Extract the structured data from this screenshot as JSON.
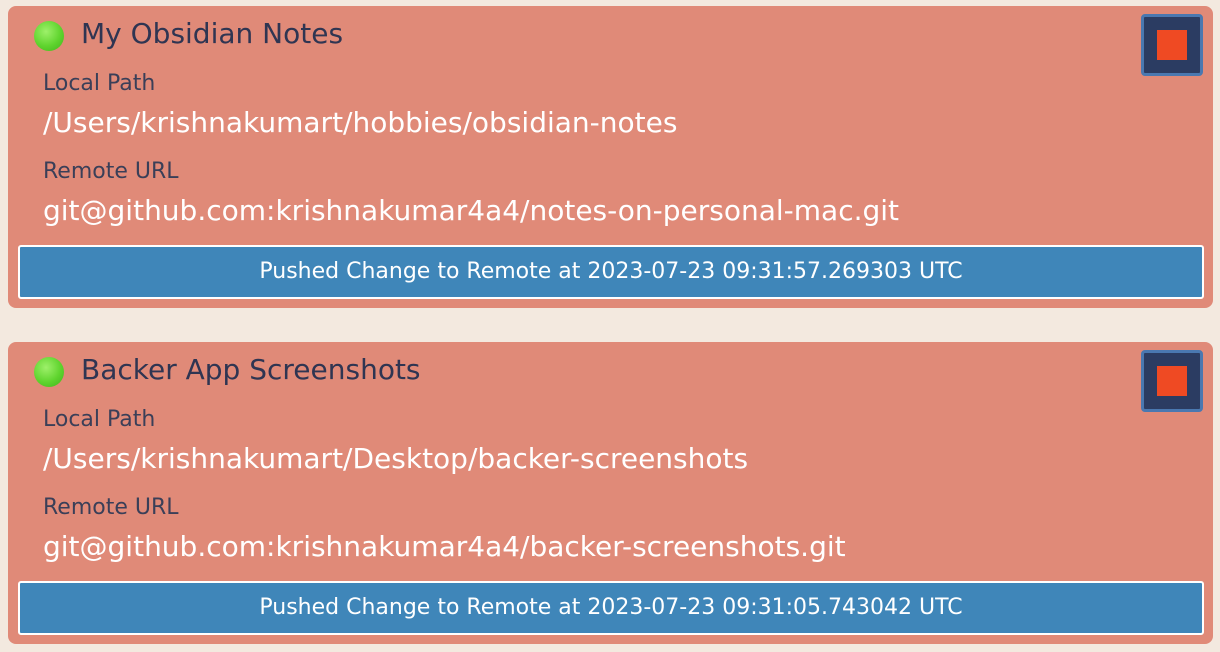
{
  "repositories": [
    {
      "title": "My Obsidian Notes",
      "status_icon": "green-status-dot",
      "local_path_label": "Local Path",
      "local_path": "/Users/krishnakumart/hobbies/obsidian-notes",
      "remote_url_label": "Remote URL",
      "remote_url": "git@github.com:krishnakumar4a4/notes-on-personal-mac.git",
      "status_message": "Pushed Change to Remote at 2023-07-23 09:31:57.269303 UTC",
      "stop_icon": "stop-square"
    },
    {
      "title": "Backer App Screenshots",
      "status_icon": "green-status-dot",
      "local_path_label": "Local Path",
      "local_path": "/Users/krishnakumart/Desktop/backer-screenshots",
      "remote_url_label": "Remote URL",
      "remote_url": "git@github.com:krishnakumar4a4/backer-screenshots.git",
      "status_message": "Pushed Change to Remote at 2023-07-23 09:31:05.743042 UTC",
      "stop_icon": "stop-square"
    }
  ],
  "colors": {
    "background": "#f3e9df",
    "card": "#e08a78",
    "status_bar": "#3f86b9",
    "stop_button": "#2b3c62",
    "stop_icon": "#ef4a23",
    "status_dot": "#5fd42e"
  }
}
